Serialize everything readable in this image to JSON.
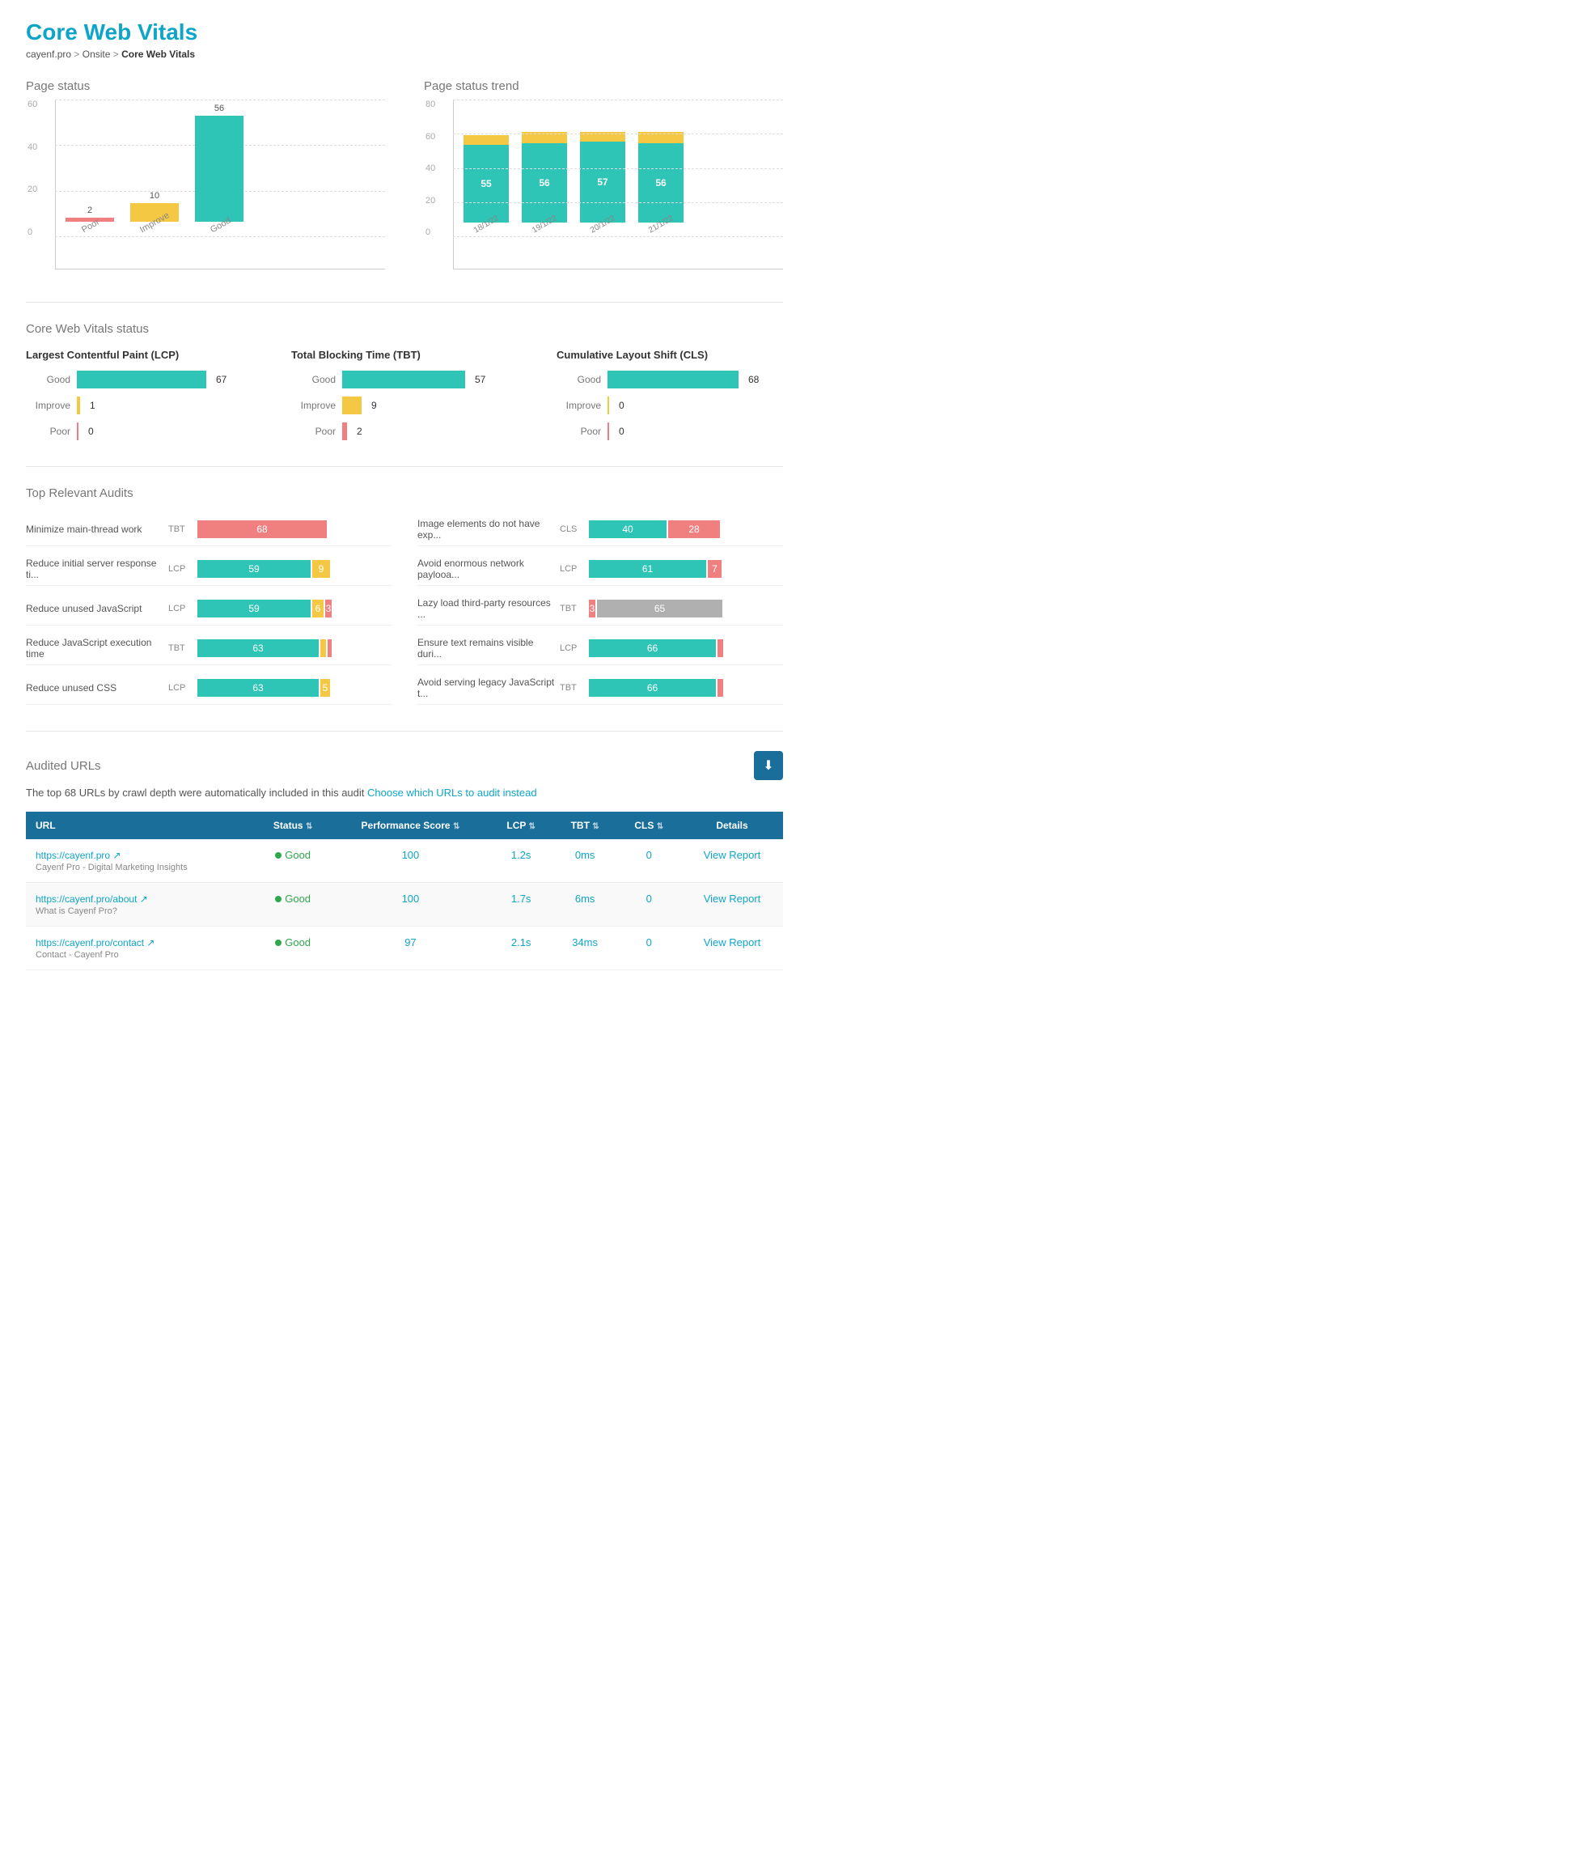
{
  "page": {
    "title": "Core Web Vitals",
    "breadcrumb": {
      "site": "cayenf.pro",
      "parent": "Onsite",
      "current": "Core Web Vitals"
    }
  },
  "pageStatus": {
    "title": "Page status",
    "yLabels": [
      "0",
      "20",
      "40",
      "60"
    ],
    "bars": [
      {
        "label": "Poor",
        "value": 2,
        "color": "#f08080"
      },
      {
        "label": "Improve",
        "value": 10,
        "color": "#f4c842"
      },
      {
        "label": "Good",
        "value": 56,
        "color": "#2ec4b6"
      }
    ]
  },
  "pageStatusTrend": {
    "title": "Page status trend",
    "yLabels": [
      "0",
      "20",
      "40",
      "60",
      "80"
    ],
    "bars": [
      {
        "label": "18/1/22",
        "good": 55,
        "improve": 7,
        "poor": 0
      },
      {
        "label": "19/1/22",
        "good": 56,
        "improve": 8,
        "poor": 0
      },
      {
        "label": "20/1/22",
        "good": 57,
        "improve": 7,
        "poor": 0
      },
      {
        "label": "21/1/22",
        "good": 56,
        "improve": 8,
        "poor": 0
      }
    ]
  },
  "coreWebVitals": {
    "title": "Core Web Vitals status",
    "metrics": [
      {
        "title": "Largest Contentful Paint (LCP)",
        "rows": [
          {
            "label": "Good",
            "value": 67,
            "color": "#2ec4b6"
          },
          {
            "label": "Improve",
            "value": 1,
            "color": "#f4c842"
          },
          {
            "label": "Poor",
            "value": 0,
            "color": "#f08080"
          }
        ]
      },
      {
        "title": "Total Blocking Time (TBT)",
        "rows": [
          {
            "label": "Good",
            "value": 57,
            "color": "#2ec4b6"
          },
          {
            "label": "Improve",
            "value": 9,
            "color": "#f4c842"
          },
          {
            "label": "Poor",
            "value": 2,
            "color": "#f08080"
          }
        ]
      },
      {
        "title": "Cumulative Layout Shift (CLS)",
        "rows": [
          {
            "label": "Good",
            "value": 68,
            "color": "#2ec4b6"
          },
          {
            "label": "Improve",
            "value": 0,
            "color": "#f4c842"
          },
          {
            "label": "Poor",
            "value": 0,
            "color": "#f08080"
          }
        ]
      }
    ]
  },
  "topAudits": {
    "title": "Top Relevant Audits",
    "items": [
      {
        "name": "Minimize main-thread work",
        "type": "TBT",
        "green": 68,
        "yellow": 0,
        "red": 0,
        "gray": 0
      },
      {
        "name": "Reduce initial server response ti...",
        "type": "LCP",
        "green": 59,
        "yellow": 9,
        "red": 0,
        "gray": 0
      },
      {
        "name": "Reduce unused JavaScript",
        "type": "LCP",
        "green": 59,
        "yellow": 6,
        "red": 3,
        "gray": 0
      },
      {
        "name": "Reduce JavaScript execution time",
        "type": "TBT",
        "green": 63,
        "yellow": 3,
        "red": 2,
        "gray": 0
      },
      {
        "name": "Reduce unused CSS",
        "type": "LCP",
        "green": 63,
        "yellow": 5,
        "red": 0,
        "gray": 0
      },
      {
        "name": "Image elements do not have exp...",
        "type": "CLS",
        "green": 40,
        "yellow": 0,
        "red": 28,
        "gray": 0
      },
      {
        "name": "Avoid enormous network paylooa...",
        "type": "LCP",
        "green": 61,
        "yellow": 0,
        "red": 7,
        "gray": 0
      },
      {
        "name": "Lazy load third-party resources ...",
        "type": "TBT",
        "green": 65,
        "yellow": 0,
        "red": 0,
        "gray": 3
      },
      {
        "name": "Ensure text remains visible duri...",
        "type": "LCP",
        "green": 66,
        "yellow": 0,
        "red": 3,
        "gray": 0
      },
      {
        "name": "Avoid serving legacy JavaScript t...",
        "type": "TBT",
        "green": 66,
        "yellow": 0,
        "red": 3,
        "gray": 0
      }
    ]
  },
  "auditedUrls": {
    "title": "Audited URLs",
    "downloadLabel": "⬇",
    "note": "The top 68 URLs by crawl depth were automatically included in this audit",
    "chooseLinkText": "Choose which URLs to audit instead",
    "table": {
      "headers": [
        "URL",
        "Status",
        "Performance Score",
        "LCP",
        "TBT",
        "CLS",
        "Details"
      ],
      "rows": [
        {
          "url": "https://cayenf.pro",
          "urlDesc": "Cayenf Pro - Digital Marketing Insights",
          "status": "Good",
          "score": "100",
          "lcp": "1.2s",
          "tbt": "0ms",
          "cls": "0",
          "details": "View Report"
        },
        {
          "url": "https://cayenf.pro/about",
          "urlDesc": "What is Cayenf Pro?",
          "status": "Good",
          "score": "100",
          "lcp": "1.7s",
          "tbt": "6ms",
          "cls": "0",
          "details": "View Report"
        },
        {
          "url": "https://cayenf.pro/contact",
          "urlDesc": "Contact - Cayenf Pro",
          "status": "Good",
          "score": "97",
          "lcp": "2.1s",
          "tbt": "34ms",
          "cls": "0",
          "details": "View Report"
        }
      ]
    }
  }
}
